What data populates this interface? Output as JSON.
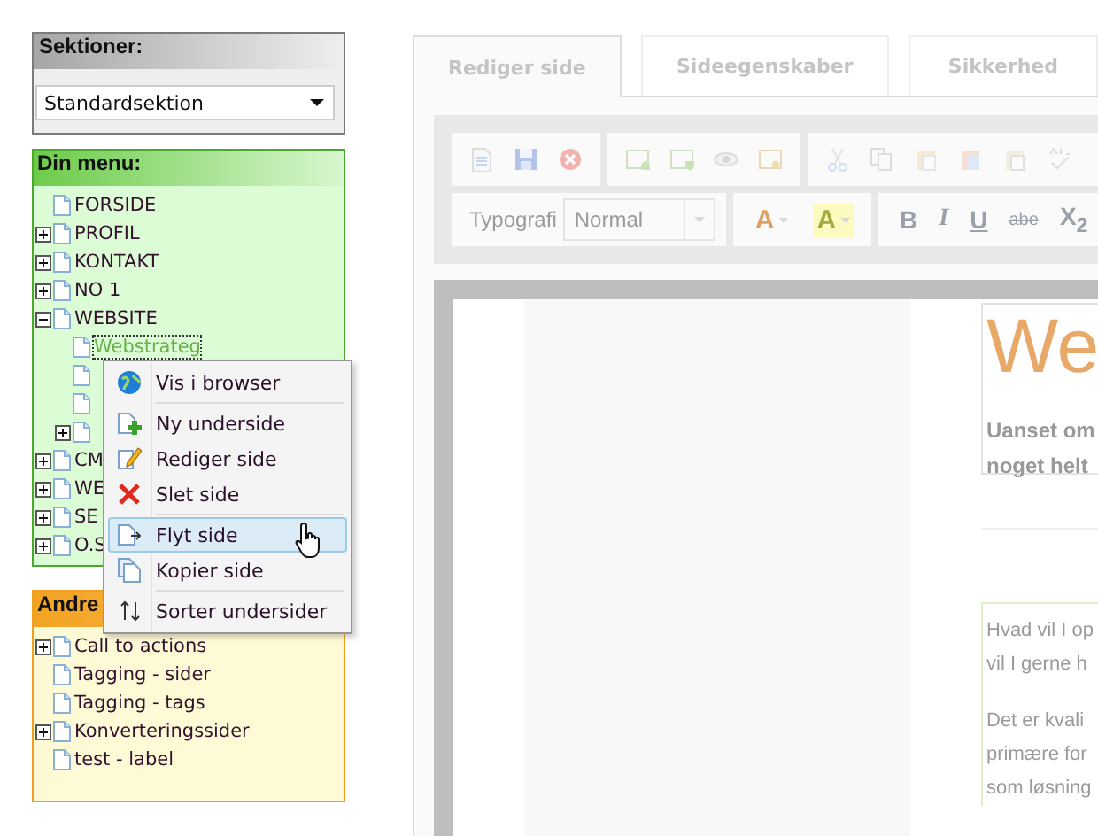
{
  "sections_panel": {
    "title": "Sektioner:",
    "select": {
      "value": "Standardsektion"
    }
  },
  "menu_panel": {
    "title": "Din menu:",
    "items": [
      {
        "label": "FORSIDE",
        "selected": false
      },
      {
        "label": "PROFIL",
        "expanded": false,
        "selected": false
      },
      {
        "label": "KONTAKT",
        "expanded": false,
        "selected": false
      },
      {
        "label": "NO 1",
        "expanded": false,
        "selected": false
      },
      {
        "label": "WEBSITE",
        "expanded": true,
        "selected": false,
        "children": [
          {
            "label": "Webstrateg",
            "selected": true
          },
          {
            "selected": false
          },
          {
            "selected": false
          },
          {
            "expanded": false,
            "selected": false
          }
        ]
      },
      {
        "label": "CM",
        "expanded": false,
        "selected": false
      },
      {
        "label": "WE",
        "expanded": false,
        "selected": false
      },
      {
        "label": "SE",
        "expanded": false,
        "selected": false
      },
      {
        "label": "O.S",
        "expanded": false,
        "selected": false
      }
    ]
  },
  "other_panel": {
    "title": "Andre",
    "items": [
      {
        "label": "Call to actions",
        "expanded": false,
        "selected": false
      },
      {
        "label": "Tagging - sider",
        "selected": false
      },
      {
        "label": "Tagging - tags",
        "selected": false
      },
      {
        "label": "Konverteringssider",
        "expanded": false,
        "selected": false
      },
      {
        "label": "test - label",
        "selected": false
      }
    ]
  },
  "context_menu": {
    "items": [
      {
        "kind": "view",
        "label": "Vis i browser",
        "selected": false,
        "divider_after": true
      },
      {
        "kind": "new",
        "label": "Ny underside",
        "selected": false,
        "divider_after": false
      },
      {
        "kind": "edit",
        "label": "Rediger side",
        "selected": false,
        "divider_after": false
      },
      {
        "kind": "delete",
        "label": "Slet side",
        "selected": false,
        "divider_after": true
      },
      {
        "kind": "move",
        "label": "Flyt side",
        "selected": true,
        "divider_after": false
      },
      {
        "kind": "copy",
        "label": "Kopier side",
        "selected": false,
        "divider_after": true
      },
      {
        "kind": "sort",
        "label": "Sorter undersider",
        "selected": false,
        "divider_after": false
      }
    ]
  },
  "editor": {
    "tabs": [
      {
        "label": "Rediger side",
        "selected": true
      },
      {
        "label": "Sideegenskaber",
        "selected": false
      },
      {
        "label": "Sikkerhed",
        "selected": false
      }
    ],
    "toolbar": {
      "style_label": "Typografi",
      "style_select": {
        "value": "Normal"
      },
      "color_buttons": [
        {
          "kind": "text",
          "label": "A"
        },
        {
          "kind": "background",
          "label": "A"
        }
      ],
      "format_buttons": [
        {
          "kind": "bold",
          "label": "B"
        },
        {
          "kind": "italic",
          "label": "I"
        },
        {
          "kind": "underline",
          "label": "U"
        },
        {
          "kind": "strike",
          "label": "abe"
        },
        {
          "kind": "subscript",
          "label": "X$_{2}$"
        }
      ]
    },
    "content": {
      "heading": "We",
      "intro_lines": [
        "Uanset om",
        "noget helt"
      ],
      "paragraphs": [
        [
          "Hvad vil I op",
          "vil I gerne h"
        ],
        [
          "Det er kvali",
          "primære for",
          "som løsning"
        ]
      ]
    }
  }
}
